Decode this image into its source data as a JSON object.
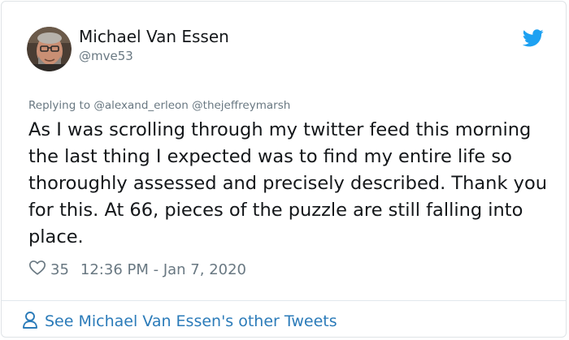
{
  "author": {
    "display_name": "Michael Van Essen",
    "handle": "@mve53"
  },
  "tweet": {
    "reply_prefix": "Replying to",
    "reply_to": "@alexand_erleon @thejeffreymarsh",
    "text": "As I was scrolling through my twitter feed this morning the last thing I expected was to find my entire life so thoroughly assessed and precisely described. Thank you for this. At 66, pieces of the puzzle are still falling into place.",
    "like_count": "35",
    "timestamp": "12:36 PM - Jan 7, 2020"
  },
  "footer": {
    "link_text": "See Michael Van Essen's other Tweets"
  },
  "icons": {
    "brand": "twitter-bird-icon",
    "like": "heart-icon",
    "profile": "person-icon"
  },
  "colors": {
    "brand_blue": "#1da1f2",
    "link_blue": "#2b7bb9",
    "secondary_text": "#697882",
    "primary_text": "#14171a"
  }
}
